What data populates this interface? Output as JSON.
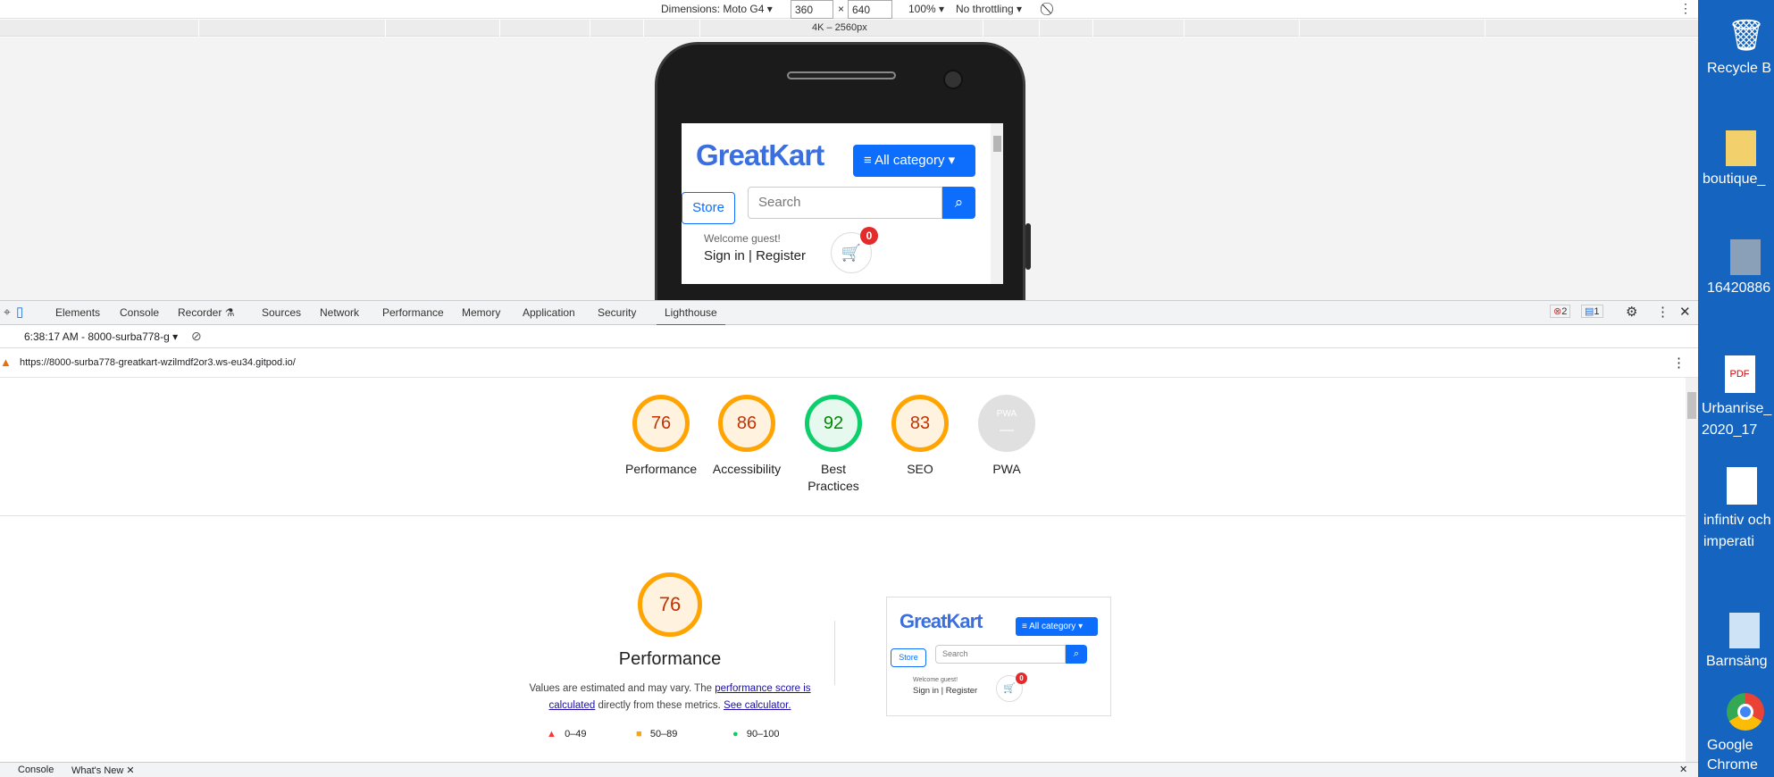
{
  "device_toolbar": {
    "dimensions_label": "Dimensions: Moto G4",
    "width": "360",
    "times": "×",
    "height": "640",
    "zoom": "100%",
    "throttling": "No throttling"
  },
  "ruler": {
    "label": "4K – 2560px"
  },
  "phone_screen": {
    "logo": "GreatKart",
    "category_button": "All category",
    "store_button": "Store",
    "search_placeholder": "Search",
    "welcome": "Welcome guest!",
    "signin": "Sign in | Register",
    "cart_count": "0"
  },
  "devtools_tabs": [
    "Elements",
    "Console",
    "Recorder",
    "Sources",
    "Network",
    "Performance",
    "Memory",
    "Application",
    "Security",
    "Lighthouse"
  ],
  "devtools_badges": {
    "errors": "2",
    "messages": "1"
  },
  "lighthouse": {
    "run_selector": "6:38:17 AM - 8000-surba778-g",
    "url": "https://8000-surba778-greatkart-wzilmdf2or3.ws-eu34.gitpod.io/",
    "scores": [
      {
        "value": "76",
        "label": "Performance"
      },
      {
        "value": "86",
        "label": "Accessibility"
      },
      {
        "value": "92",
        "label": "Best Practices"
      },
      {
        "value": "83",
        "label": "SEO"
      },
      {
        "value": "PWA",
        "label": "PWA"
      }
    ],
    "perf_score": "76",
    "perf_title": "Performance",
    "perf_desc_1": "Values are estimated and may vary. The ",
    "perf_link_1": "performance score is calculated",
    "perf_desc_2": " directly from these metrics. ",
    "perf_link_2": "See calculator.",
    "legend": [
      "0–49",
      "50–89",
      "90–100"
    ],
    "colors": {
      "fail": "#ff3333",
      "average": "#ffa400",
      "pass": "#0cce6b"
    }
  },
  "bottom_tabs": {
    "console": "Console",
    "whats_new": "What's New"
  },
  "desktop_icons": [
    "Recycle B",
    "boutique_",
    "16420886",
    "Urbanrise_ 2020_17",
    "infintiv och imperati",
    "Barnsäng",
    "Google Chrome"
  ]
}
